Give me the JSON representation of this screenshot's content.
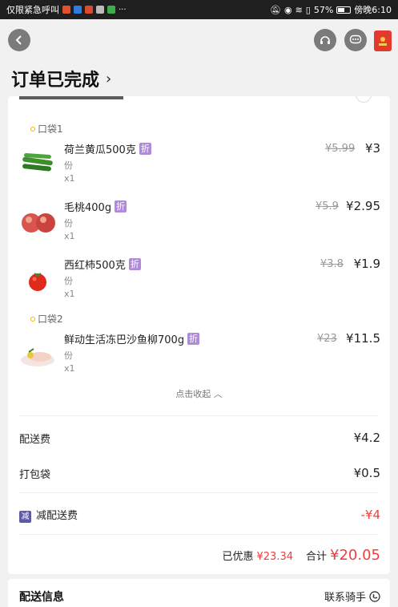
{
  "status_bar": {
    "carrier": "仅限紧急呼叫",
    "more": "···",
    "battery": "57%",
    "battery_level": 0.57,
    "time": "傍晚6:10"
  },
  "header": {
    "title": "订单已完成",
    "title_chevron": "›",
    "icons": [
      "back-arrow-icon",
      "headset-icon",
      "chat-icon",
      "red-packet-icon"
    ]
  },
  "bags": [
    {
      "label": "口袋1",
      "items": [
        {
          "name": "荷兰黄瓜500克",
          "tag": "折",
          "unit": "份",
          "qty": "x1",
          "old_price": "¥5.99",
          "price": "¥3"
        },
        {
          "name": "毛桃400g",
          "tag": "折",
          "unit": "份",
          "qty": "x1",
          "old_price": "¥5.9",
          "price": "¥2.95"
        },
        {
          "name": "西红柿500克",
          "tag": "折",
          "unit": "份",
          "qty": "x1",
          "old_price": "¥3.8",
          "price": "¥1.9"
        }
      ]
    },
    {
      "label": "口袋2",
      "items": [
        {
          "name": "鲜动生活冻巴沙鱼柳700g",
          "tag": "折",
          "unit": "份",
          "qty": "x1",
          "old_price": "¥23",
          "price": "¥11.5"
        }
      ]
    }
  ],
  "collapse_label": "点击收起",
  "collapse_chevron": "︿",
  "fees": {
    "delivery_label": "配送费",
    "delivery_value": "¥4.2",
    "bag_label": "打包袋",
    "bag_value": "¥0.5",
    "reduce_tag": "减",
    "reduce_label": "减配送费",
    "reduce_value": "-¥4"
  },
  "summary": {
    "discount_label": "已优惠",
    "discount_value": "¥23.34",
    "total_label": "合计",
    "total_value": "¥20.05"
  },
  "delivery_info": {
    "title": "配送信息",
    "right_text": "联系骑手"
  },
  "colors": {
    "accent_red": "#f03e3e",
    "discount_tag": "#b08ad8",
    "reduce_tag": "#5a5aa6"
  }
}
